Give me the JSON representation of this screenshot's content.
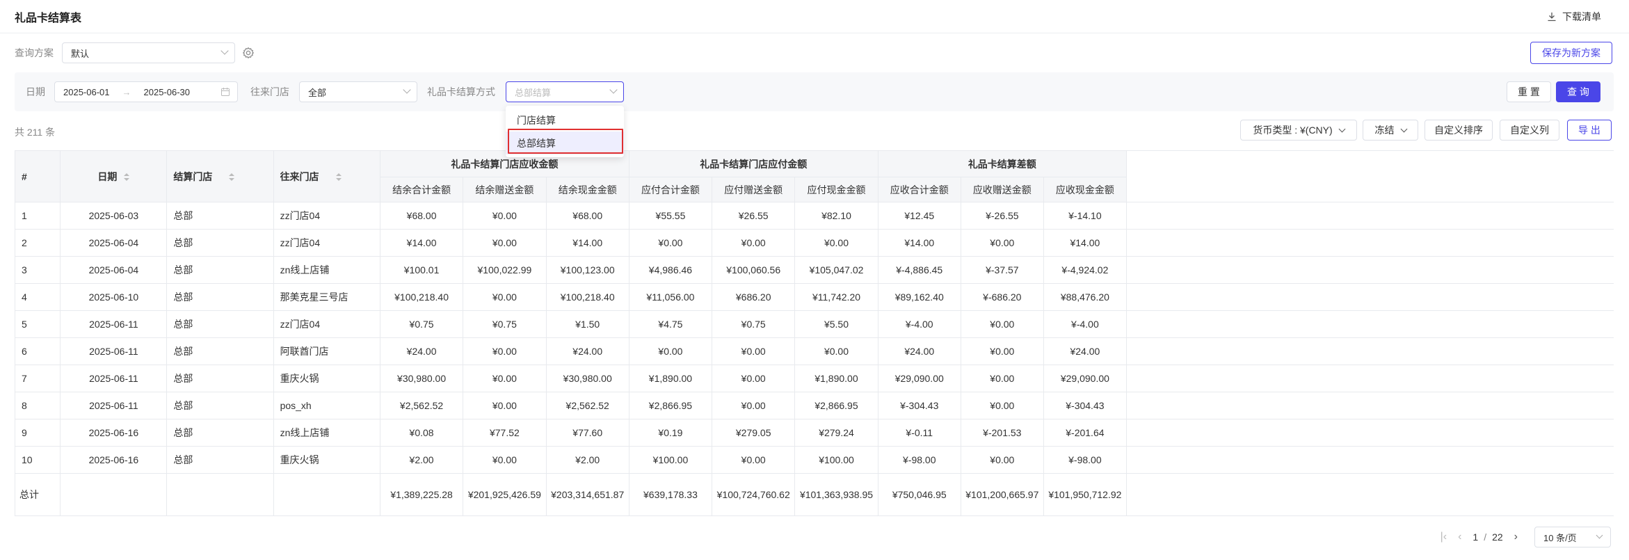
{
  "header": {
    "title": "礼品卡结算表",
    "download_label": "下载清单"
  },
  "scheme": {
    "label": "查询方案",
    "value": "默认",
    "save_label": "保存为新方案"
  },
  "filters": {
    "date_label": "日期",
    "date_start": "2025-06-01",
    "date_arrow": "→",
    "date_end": "2025-06-30",
    "store_label": "往来门店",
    "store_value": "全部",
    "method_label": "礼品卡结算方式",
    "method_placeholder": "总部结算",
    "reset_label": "重 置",
    "query_label": "查 询"
  },
  "dropdown": {
    "options": [
      "门店结算",
      "总部结算"
    ],
    "selected": "总部结算"
  },
  "toolbar": {
    "count": "共 211 条",
    "currency": "货币类型 : ¥(CNY)",
    "freeze": "冻结",
    "custom_sort": "自定义排序",
    "custom_cols": "自定义列",
    "export": "导 出"
  },
  "table": {
    "fixed_headers": [
      "#",
      "日期",
      "结算门店",
      "往来门店"
    ],
    "groups": [
      "礼品卡结算门店应收金额",
      "礼品卡结算门店应付金额",
      "礼品卡结算差额"
    ],
    "sub_headers": [
      "结余合计金额",
      "结余赠送金额",
      "结余现金金额",
      "应付合计金额",
      "应付赠送金额",
      "应付现金金额",
      "应收合计金额",
      "应收赠送金额",
      "应收现金金额"
    ],
    "rows": [
      [
        "1",
        "2025-06-03",
        "总部",
        "zz门店04",
        "¥68.00",
        "¥0.00",
        "¥68.00",
        "¥55.55",
        "¥26.55",
        "¥82.10",
        "¥12.45",
        "¥-26.55",
        "¥-14.10"
      ],
      [
        "2",
        "2025-06-04",
        "总部",
        "zz门店04",
        "¥14.00",
        "¥0.00",
        "¥14.00",
        "¥0.00",
        "¥0.00",
        "¥0.00",
        "¥14.00",
        "¥0.00",
        "¥14.00"
      ],
      [
        "3",
        "2025-06-04",
        "总部",
        "zn线上店铺",
        "¥100.01",
        "¥100,022.99",
        "¥100,123.00",
        "¥4,986.46",
        "¥100,060.56",
        "¥105,047.02",
        "¥-4,886.45",
        "¥-37.57",
        "¥-4,924.02"
      ],
      [
        "4",
        "2025-06-10",
        "总部",
        "那美克星三号店",
        "¥100,218.40",
        "¥0.00",
        "¥100,218.40",
        "¥11,056.00",
        "¥686.20",
        "¥11,742.20",
        "¥89,162.40",
        "¥-686.20",
        "¥88,476.20"
      ],
      [
        "5",
        "2025-06-11",
        "总部",
        "zz门店04",
        "¥0.75",
        "¥0.75",
        "¥1.50",
        "¥4.75",
        "¥0.75",
        "¥5.50",
        "¥-4.00",
        "¥0.00",
        "¥-4.00"
      ],
      [
        "6",
        "2025-06-11",
        "总部",
        "阿联酋门店",
        "¥24.00",
        "¥0.00",
        "¥24.00",
        "¥0.00",
        "¥0.00",
        "¥0.00",
        "¥24.00",
        "¥0.00",
        "¥24.00"
      ],
      [
        "7",
        "2025-06-11",
        "总部",
        "重庆火锅",
        "¥30,980.00",
        "¥0.00",
        "¥30,980.00",
        "¥1,890.00",
        "¥0.00",
        "¥1,890.00",
        "¥29,090.00",
        "¥0.00",
        "¥29,090.00"
      ],
      [
        "8",
        "2025-06-11",
        "总部",
        "pos_xh",
        "¥2,562.52",
        "¥0.00",
        "¥2,562.52",
        "¥2,866.95",
        "¥0.00",
        "¥2,866.95",
        "¥-304.43",
        "¥0.00",
        "¥-304.43"
      ],
      [
        "9",
        "2025-06-16",
        "总部",
        "zn线上店铺",
        "¥0.08",
        "¥77.52",
        "¥77.60",
        "¥0.19",
        "¥279.05",
        "¥279.24",
        "¥-0.11",
        "¥-201.53",
        "¥-201.64"
      ],
      [
        "10",
        "2025-06-16",
        "总部",
        "重庆火锅",
        "¥2.00",
        "¥0.00",
        "¥2.00",
        "¥100.00",
        "¥0.00",
        "¥100.00",
        "¥-98.00",
        "¥0.00",
        "¥-98.00"
      ]
    ],
    "total_label": "总计",
    "totals": [
      "¥1,389,225.28",
      "¥201,925,426.59",
      "¥203,314,651.87",
      "¥639,178.33",
      "¥100,724,760.62",
      "¥101,363,938.95",
      "¥750,046.95",
      "¥101,200,665.97",
      "¥101,950,712.92"
    ]
  },
  "pagination": {
    "current": "1",
    "separator": "/",
    "total": "22",
    "page_size": "10 条/页"
  },
  "colors": {
    "primary": "#4a46e8",
    "highlight": "#e03030"
  }
}
